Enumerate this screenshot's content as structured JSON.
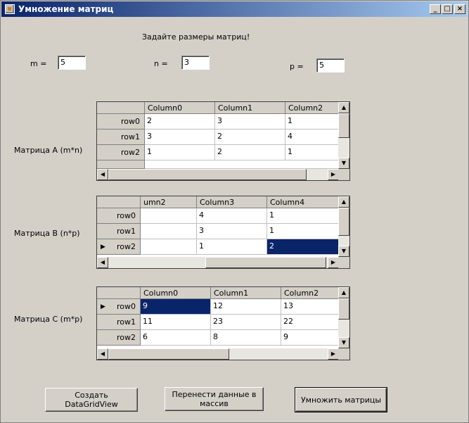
{
  "window": {
    "title": "Умножение матриц"
  },
  "prompt": "Задайте размеры матриц!",
  "dims": [
    {
      "label": "m =",
      "value": "5"
    },
    {
      "label": "n =",
      "value": "3"
    },
    {
      "label": "p =",
      "value": "5"
    }
  ],
  "matrixA": {
    "label": "Матрица A (m*n)",
    "columns": [
      "Column0",
      "Column1",
      "Column2"
    ],
    "rows": [
      {
        "header": "row0",
        "cells": [
          "2",
          "3",
          "1"
        ]
      },
      {
        "header": "row1",
        "cells": [
          "3",
          "2",
          "4"
        ]
      },
      {
        "header": "row2",
        "cells": [
          "1",
          "2",
          "1"
        ]
      }
    ]
  },
  "matrixB": {
    "label": "Матрица B (n*p)",
    "columns": [
      "umn2",
      "Column3",
      "Column4"
    ],
    "rows": [
      {
        "header": "row0",
        "cells": [
          "",
          "4",
          "1"
        ]
      },
      {
        "header": "row1",
        "cells": [
          "",
          "3",
          "1"
        ]
      },
      {
        "header": "row2",
        "cells": [
          "",
          "1",
          "2"
        ]
      }
    ]
  },
  "matrixC": {
    "label": "Матрица C (m*p)",
    "columns": [
      "Column0",
      "Column1",
      "Column2"
    ],
    "rows": [
      {
        "header": "row0",
        "cells": [
          "9",
          "12",
          "13"
        ]
      },
      {
        "header": "row1",
        "cells": [
          "11",
          "23",
          "22"
        ]
      },
      {
        "header": "row2",
        "cells": [
          "6",
          "8",
          "9"
        ]
      }
    ]
  },
  "buttons": {
    "create": "Создать DataGridView",
    "transfer_line1": "Перенести данные в",
    "transfer_line2": "массив",
    "multiply": "Умножить матрицы"
  }
}
